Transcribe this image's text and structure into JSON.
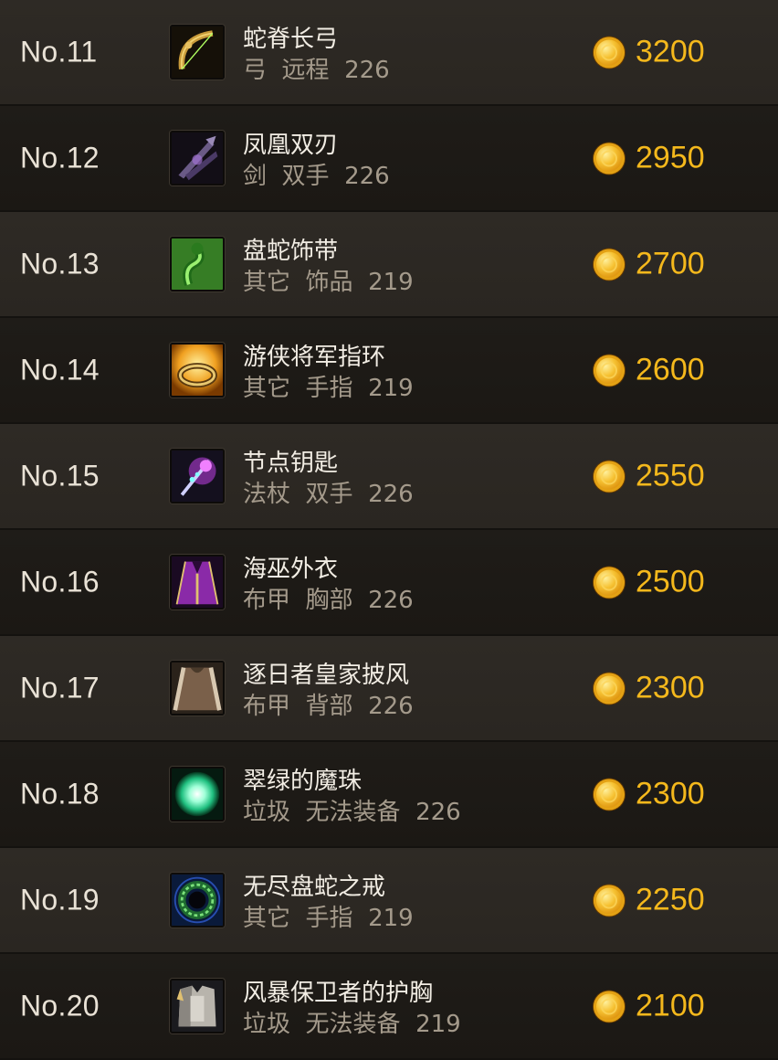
{
  "items": [
    {
      "rank": "No.11",
      "name": "蛇脊长弓",
      "type": "弓",
      "slot": "远程",
      "level": "226",
      "price": "3200",
      "icon": "longbow-icon",
      "color": "#d8b040"
    },
    {
      "rank": "No.12",
      "name": "凤凰双刃",
      "type": "剑",
      "slot": "双手",
      "level": "226",
      "price": "2950",
      "icon": "twin-blades-icon",
      "color": "#7a5aa0"
    },
    {
      "rank": "No.13",
      "name": "盘蛇饰带",
      "type": "其它",
      "slot": "饰品",
      "level": "219",
      "price": "2700",
      "icon": "coiled-serpent-icon",
      "color": "#4cc84a"
    },
    {
      "rank": "No.14",
      "name": "游侠将军指环",
      "type": "其它",
      "slot": "手指",
      "level": "219",
      "price": "2600",
      "icon": "golden-ring-icon",
      "color": "#f2b12a"
    },
    {
      "rank": "No.15",
      "name": "节点钥匙",
      "type": "法杖",
      "slot": "双手",
      "level": "226",
      "price": "2550",
      "icon": "arcane-staff-icon",
      "color": "#c94ce8"
    },
    {
      "rank": "No.16",
      "name": "海巫外衣",
      "type": "布甲",
      "slot": "胸部",
      "level": "226",
      "price": "2500",
      "icon": "robe-icon",
      "color": "#8a2aa8"
    },
    {
      "rank": "No.17",
      "name": "逐日者皇家披风",
      "type": "布甲",
      "slot": "背部",
      "level": "226",
      "price": "2300",
      "icon": "cloak-icon",
      "color": "#9a8068"
    },
    {
      "rank": "No.18",
      "name": "翠绿的魔珠",
      "type": "垃圾",
      "slot": "无法装备",
      "level": "226",
      "price": "2300",
      "icon": "green-orb-icon",
      "color": "#3ae0a0"
    },
    {
      "rank": "No.19",
      "name": "无尽盘蛇之戒",
      "type": "其它",
      "slot": "手指",
      "level": "219",
      "price": "2250",
      "icon": "serpent-ring-icon",
      "color": "#2a8a4a"
    },
    {
      "rank": "No.20",
      "name": "风暴保卫者的护胸",
      "type": "垃圾",
      "slot": "无法装备",
      "level": "219",
      "price": "2100",
      "icon": "chest-armor-icon",
      "color": "#c8c4bc"
    }
  ],
  "colors": {
    "rank_text": "#e9e2d6",
    "name_text": "#f2ede4",
    "meta_text": "#a49a8b",
    "price_text": "#f4b81c",
    "row_light": "#2c2823",
    "row_dark": "#1d1a16"
  }
}
